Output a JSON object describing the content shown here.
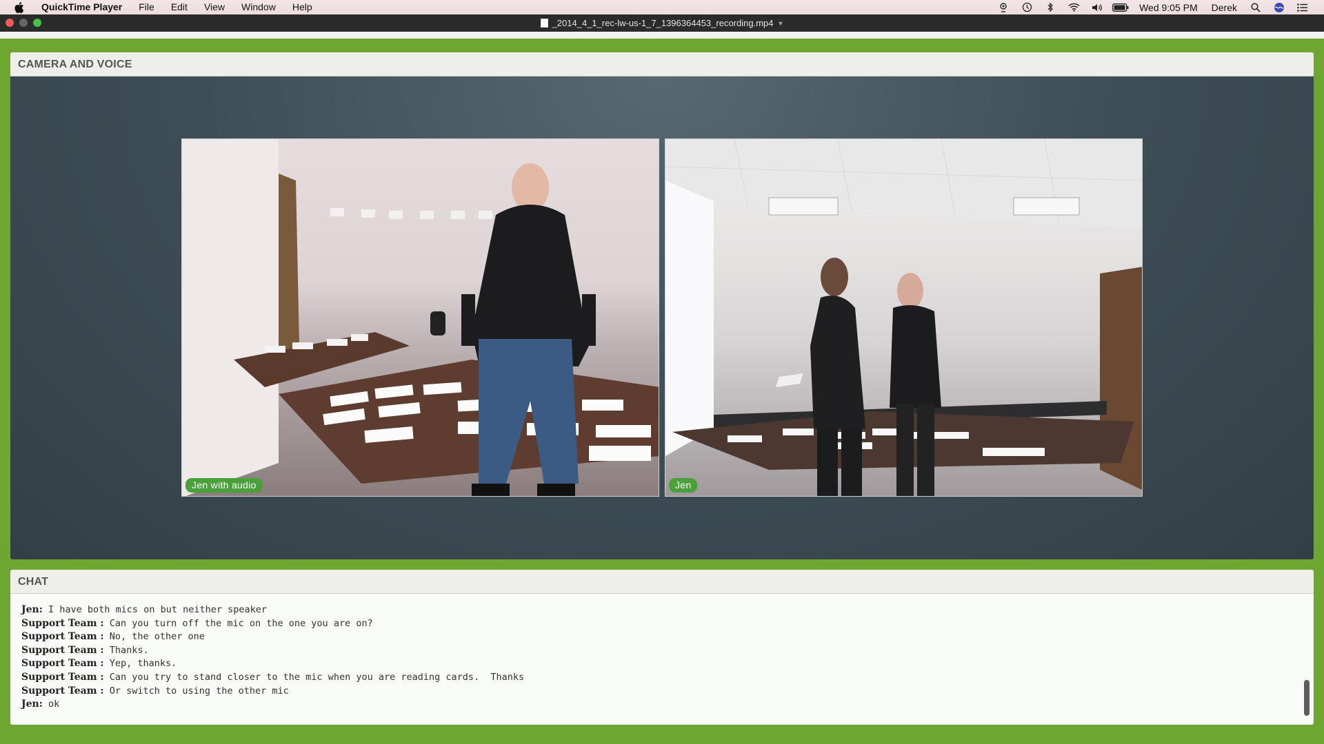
{
  "menubar": {
    "app_name": "QuickTime Player",
    "menus": [
      "File",
      "Edit",
      "View",
      "Window",
      "Help"
    ],
    "clock": "Wed 9:05 PM",
    "user": "Derek",
    "icons": [
      "airdrop-icon",
      "time-machine-icon",
      "bluetooth-icon",
      "wifi-icon",
      "volume-icon",
      "battery-icon"
    ]
  },
  "window": {
    "title": "_2014_4_1_rec-lw-us-1_7_1396364453_recording.mp4"
  },
  "camera_panel": {
    "header": "CAMERA AND VOICE",
    "videos": [
      {
        "label": "Jen with audio"
      },
      {
        "label": "Jen"
      }
    ]
  },
  "chat_panel": {
    "header": "CHAT",
    "messages": [
      {
        "sender": "Jen:",
        "text": " I have both mics on but neither speaker"
      },
      {
        "sender": "Support Team :",
        "text": " Can you turn off the mic on the one you are on?"
      },
      {
        "sender": "Support Team :",
        "text": " No, the other one"
      },
      {
        "sender": "Support Team :",
        "text": " Thanks."
      },
      {
        "sender": "Support Team :",
        "text": " Yep, thanks."
      },
      {
        "sender": "Support Team :",
        "text": " Can you try to stand closer to the mic when you are reading cards.  Thanks"
      },
      {
        "sender": "Support Team :",
        "text": " Or switch to using the other mic"
      },
      {
        "sender": "Jen:",
        "text": " ok"
      }
    ]
  },
  "colors": {
    "app_background": "#6fa631",
    "label_green": "#4aa13a"
  }
}
